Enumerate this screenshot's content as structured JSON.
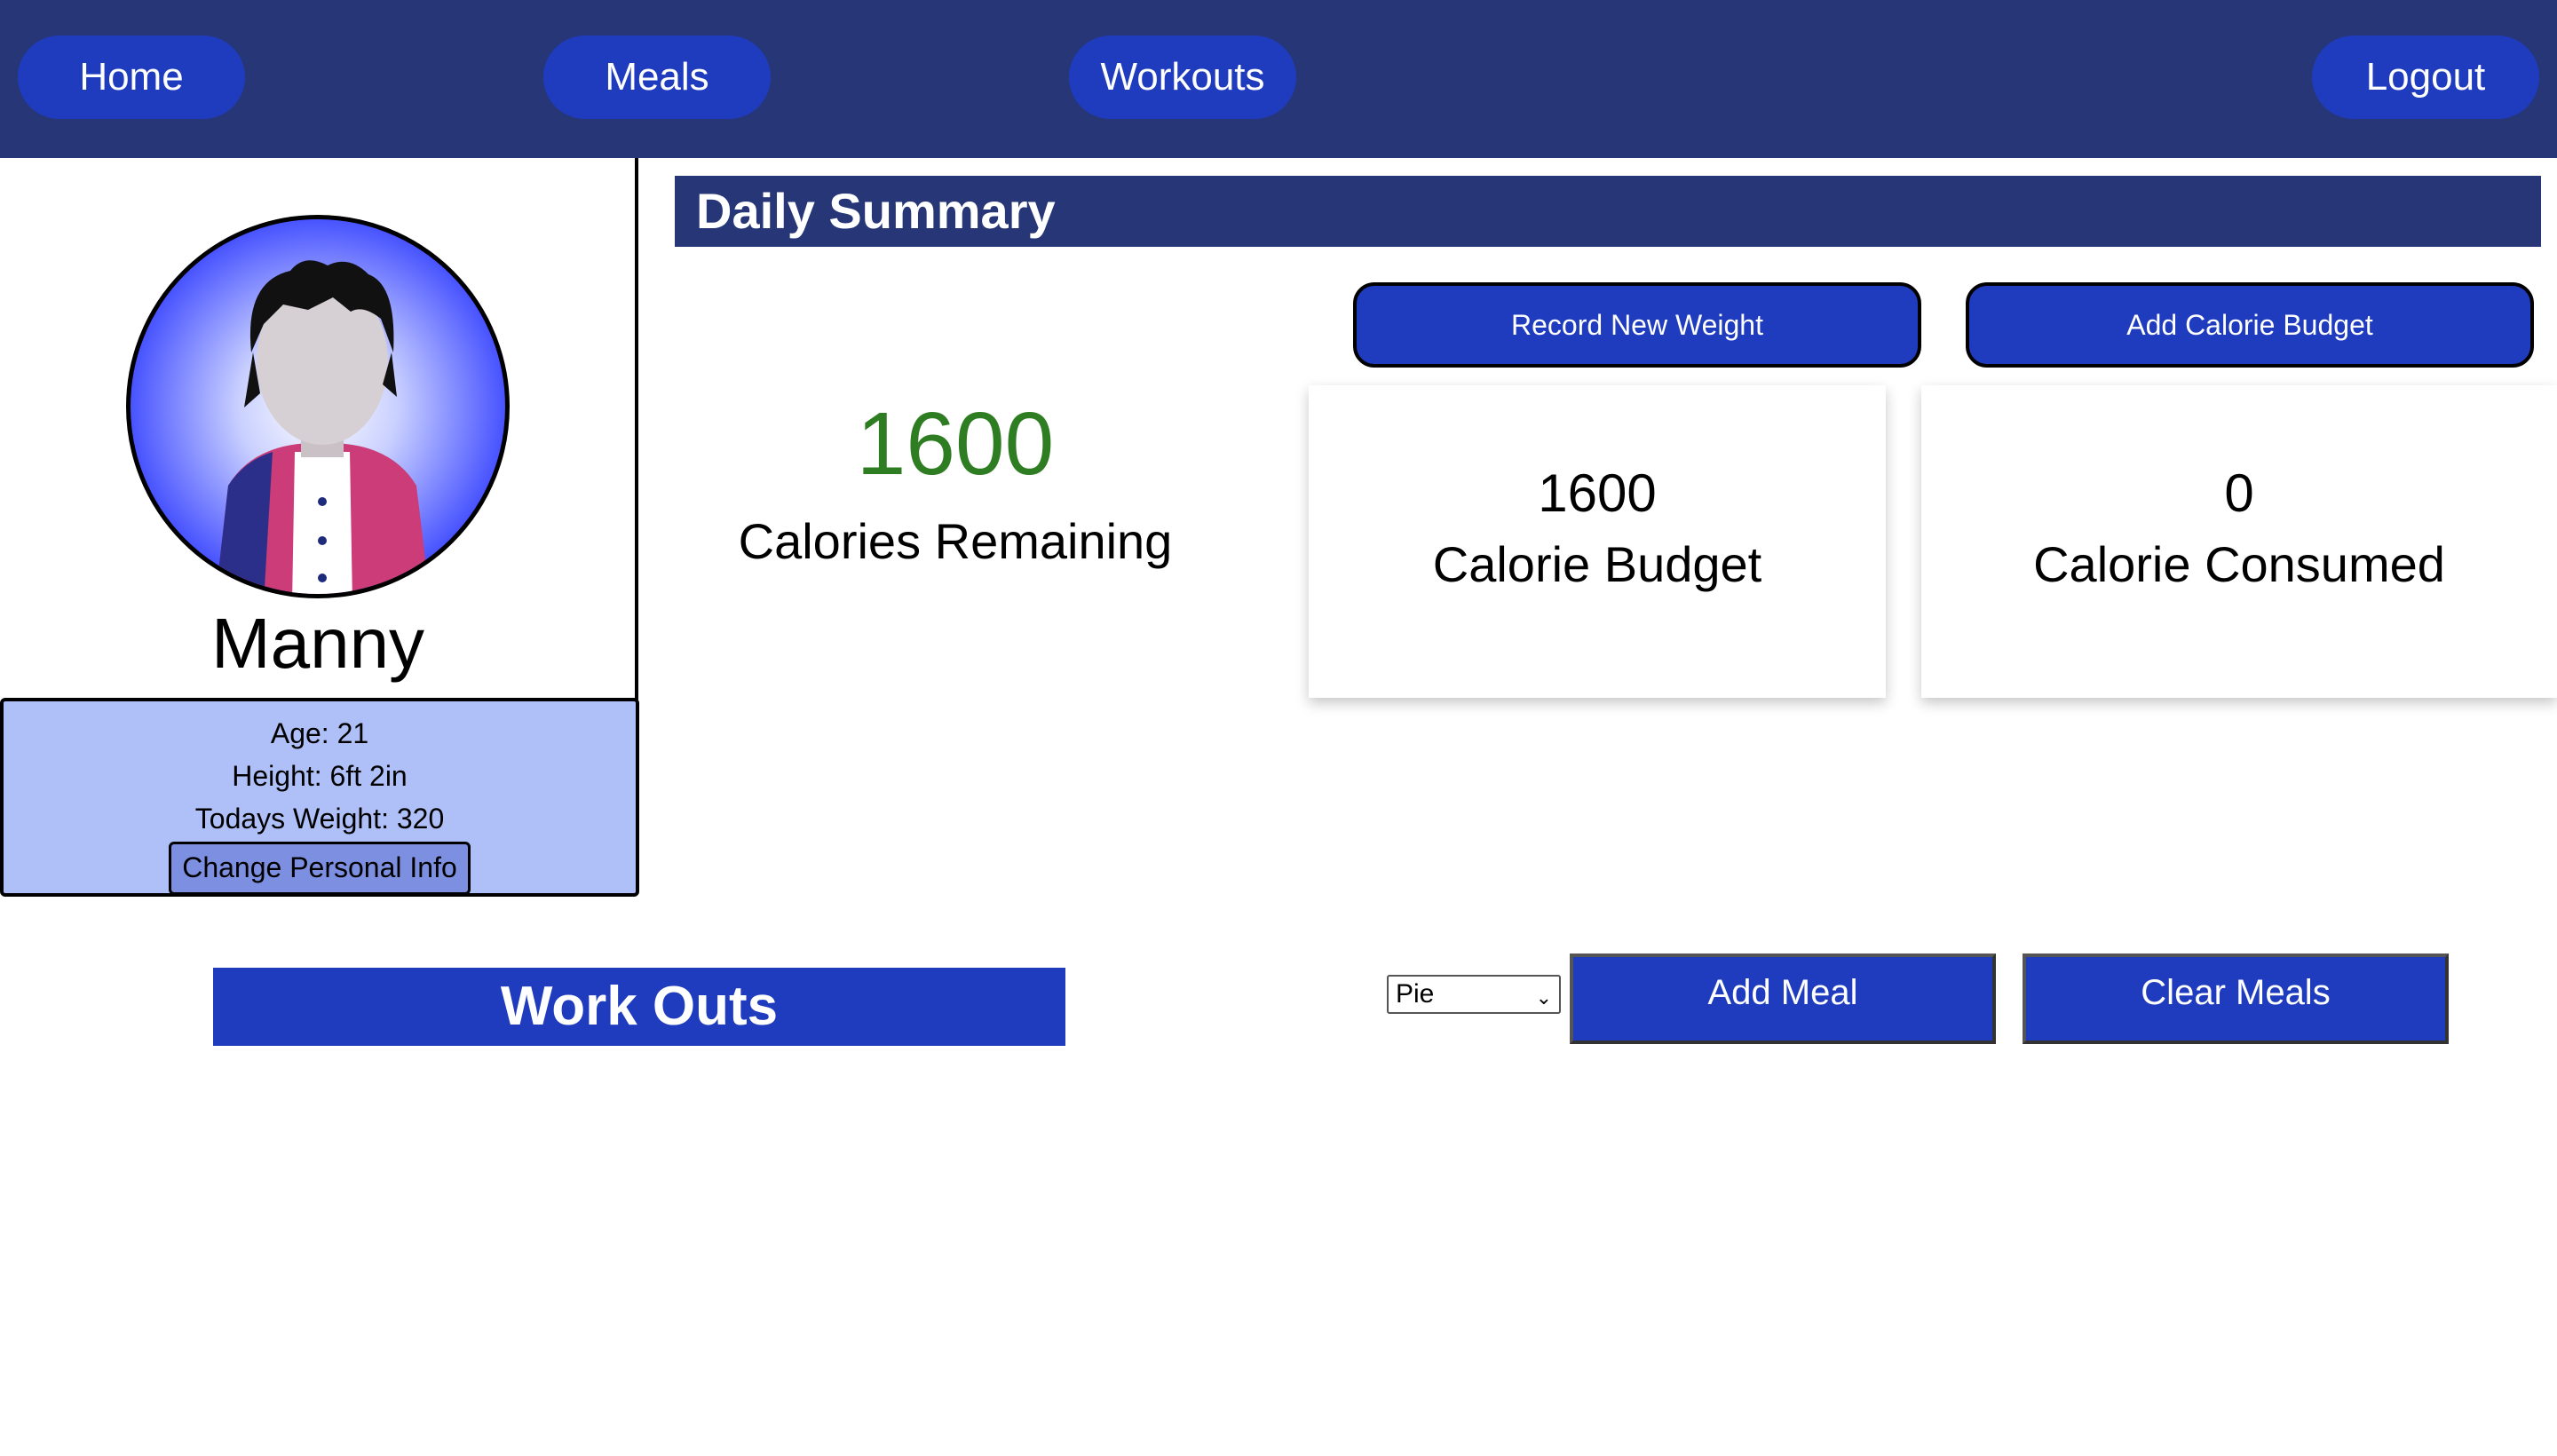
{
  "nav": {
    "home": "Home",
    "meals": "Meals",
    "workouts": "Workouts",
    "logout": "Logout"
  },
  "profile": {
    "name": "Manny",
    "age": "Age: 21",
    "height": "Height: 6ft 2in",
    "weight": "Todays Weight: 320",
    "change_button": "Change Personal Info"
  },
  "summary": {
    "title": "Daily Summary",
    "record_weight_button": "Record New Weight",
    "add_budget_button": "Add Calorie Budget",
    "remaining_value": "1600",
    "remaining_label": "Calories Remaining",
    "budget_value": "1600",
    "budget_label": "Calorie Budget",
    "consumed_value": "0",
    "consumed_label": "Calorie Consumed"
  },
  "workouts": {
    "title": "Work Outs"
  },
  "meals": {
    "selected": "Pie",
    "add_button": "Add Meal",
    "clear_button": "Clear Meals"
  },
  "colors": {
    "nav_bg": "#263677",
    "accent_blue": "#1f3cbf",
    "info_box_bg": "#afbff7",
    "remaining_green": "#2f7d22"
  }
}
